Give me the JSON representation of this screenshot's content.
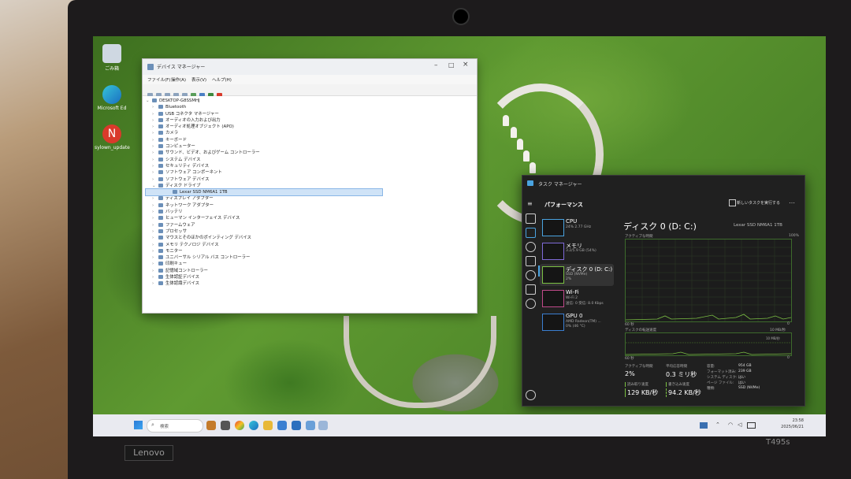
{
  "desktop_icons": [
    {
      "label": "ごみ箱",
      "icon": "recycle-bin-icon"
    },
    {
      "label": "Microsoft Ed",
      "icon": "edge-icon"
    },
    {
      "label": "sylown_update",
      "icon": "app-n-icon"
    }
  ],
  "device_manager": {
    "title": "デバイス マネージャー",
    "menu": [
      "ファイル(F)",
      "操作(A)",
      "表示(V)",
      "ヘルプ(H)"
    ],
    "root": "DESKTOP-G8SSMHJ",
    "tree": [
      {
        "label": "Bluetooth",
        "expanded": false
      },
      {
        "label": "USB コネクタ マネージャー",
        "expanded": false
      },
      {
        "label": "オーディオの入力および出力",
        "expanded": false
      },
      {
        "label": "オーディオ処理オブジェクト (APO)",
        "expanded": false
      },
      {
        "label": "カメラ",
        "expanded": false
      },
      {
        "label": "キーボード",
        "expanded": false
      },
      {
        "label": "コンピューター",
        "expanded": false
      },
      {
        "label": "サウンド、ビデオ、およびゲーム コントローラー",
        "expanded": false
      },
      {
        "label": "システム デバイス",
        "expanded": false
      },
      {
        "label": "セキュリティ デバイス",
        "expanded": false
      },
      {
        "label": "ソフトウェア コンポーネント",
        "expanded": false
      },
      {
        "label": "ソフトウェア デバイス",
        "expanded": false
      },
      {
        "label": "ディスク ドライブ",
        "expanded": true
      },
      {
        "label": "Lexar SSD NM6A1 1TB",
        "child": true,
        "selected": true
      },
      {
        "label": "ディスプレイ アダプター",
        "expanded": false
      },
      {
        "label": "ネットワーク アダプター",
        "expanded": false
      },
      {
        "label": "バッテリ",
        "expanded": false
      },
      {
        "label": "ヒューマン インターフェイス デバイス",
        "expanded": false
      },
      {
        "label": "ファームウェア",
        "expanded": false
      },
      {
        "label": "プロセッサ",
        "expanded": false
      },
      {
        "label": "マウスとそのほかのポインティング デバイス",
        "expanded": false
      },
      {
        "label": "メモリ テクノロジ デバイス",
        "expanded": false
      },
      {
        "label": "モニター",
        "expanded": false
      },
      {
        "label": "ユニバーサル シリアル バス コントローラー",
        "expanded": false
      },
      {
        "label": "印刷キュー",
        "expanded": false
      },
      {
        "label": "記憶域コントローラー",
        "expanded": false
      },
      {
        "label": "生体認証デバイス",
        "expanded": false
      },
      {
        "label": "生体認識デバイス",
        "expanded": false
      }
    ]
  },
  "task_manager": {
    "title": "タスク マネージャー",
    "section": "パフォーマンス",
    "run_task_label": "新しいタスクを実行する",
    "items": [
      {
        "name": "CPU",
        "sub1": "24% 2.77 GHz",
        "sub2": ""
      },
      {
        "name": "メモリ",
        "sub1": "3.2/5.9 GB (54%)",
        "sub2": ""
      },
      {
        "name": "ディスク 0 (D: C:)",
        "sub1": "SSD (NVMe)",
        "sub2": "2%"
      },
      {
        "name": "Wi-Fi",
        "sub1": "Wi-Fi 2",
        "sub2": "送信: 0 受信: 8.0 Kbps"
      },
      {
        "name": "GPU 0",
        "sub1": "AMD Radeon(TM) ...",
        "sub2": "0% (46 °C)"
      }
    ],
    "main": {
      "title": "ディスク 0 (D: C:)",
      "model": "Lexar SSD NM6A1 1TB",
      "chart1_label": "アクティブな時間",
      "chart1_max": "100%",
      "chart1_time": "60 秒",
      "chart1_min": "0",
      "chart2_label": "ディスクの転送速度",
      "chart2_max": "10 MB/秒",
      "chart2_sub": "10 MB/秒",
      "chart2_time": "60 秒",
      "chart2_min": "0",
      "stats": {
        "active_label": "アクティブな時間",
        "active_value": "2%",
        "resp_label": "平均応答時間",
        "resp_value": "0.3 ミリ秒",
        "read_label": "読み取り速度",
        "read_value": "129 KB/秒",
        "write_label": "書き込み速度",
        "write_value": "94.2 KB/秒",
        "cap_label": "容量:",
        "cap_value": "954 GB",
        "fmt_label": "フォーマット済み:",
        "fmt_value": "239 GB",
        "sys_label": "システム ディスク:",
        "sys_value": "はい",
        "page_label": "ページ ファイル:",
        "page_value": "はい",
        "type_label": "種類:",
        "type_value": "SSD (NVMe)"
      }
    },
    "accent": "#4aa3e0",
    "disk_color": "#7bc043"
  },
  "taskbar": {
    "search_label": "検索",
    "time": "23:58",
    "date": "2025/06/21"
  },
  "hardware": {
    "brand": "Lenovo",
    "model": "T495s"
  }
}
